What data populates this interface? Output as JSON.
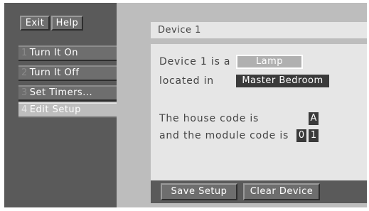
{
  "toolbar": {
    "exit_label": "Exit",
    "help_label": "Help"
  },
  "menu": {
    "items": [
      {
        "number": "1",
        "label": "Turn It On"
      },
      {
        "number": "2",
        "label": "Turn It Off"
      },
      {
        "number": "3",
        "label": "Set Timers..."
      },
      {
        "number": "4",
        "label": "Edit Setup"
      }
    ],
    "selected": "Edit Setup"
  },
  "device": {
    "title": "Device 1",
    "type_prefix": "Device 1 is a",
    "type_value": "Lamp",
    "location_prefix": "located in",
    "location_value": "Master Bedroom",
    "house_code_label": "The house code is",
    "house_code": "A",
    "module_code_label": "and the module code is",
    "module_code_digits": [
      "0",
      "1"
    ]
  },
  "actions": {
    "save_label": "Save Setup",
    "clear_label": "Clear Device"
  },
  "colors": {
    "sidebar_bg": "#5a5a5a",
    "panel_bg": "#bdbdbd",
    "content_bg": "#e6e6e6",
    "field_dark": "#3a3a3a"
  }
}
